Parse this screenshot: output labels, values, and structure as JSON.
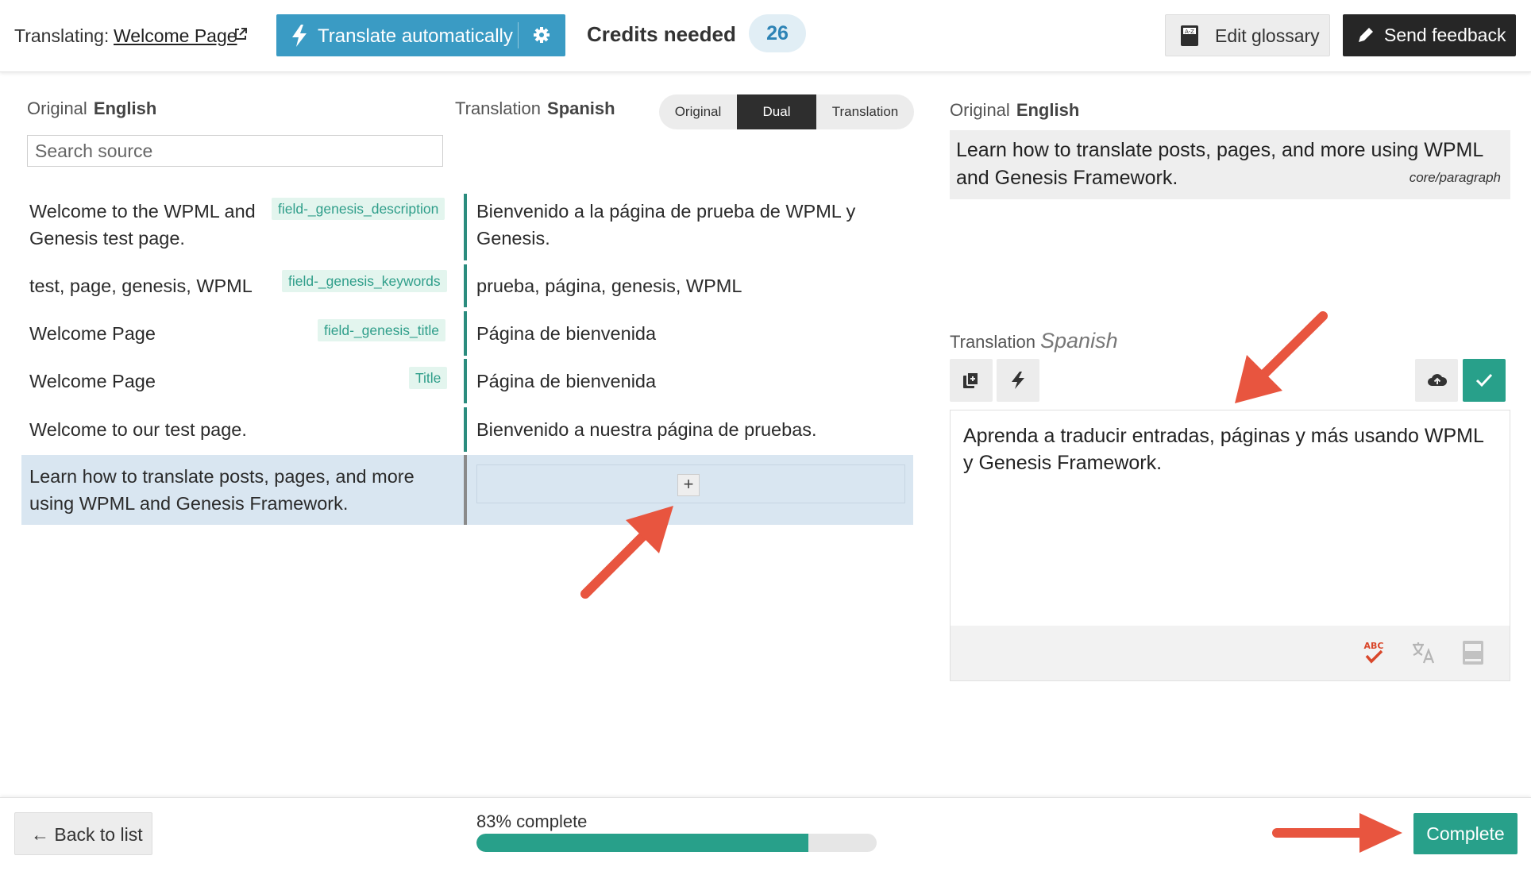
{
  "header": {
    "translating_label": "Translating:",
    "page_link": "Welcome Page",
    "translate_auto_label": "Translate automatically",
    "credits_label": "Credits needed",
    "credits_value": "26",
    "edit_glossary_label": "Edit glossary",
    "send_feedback_label": "Send feedback"
  },
  "columns": {
    "original_label": "Original",
    "original_lang": "English",
    "translation_label": "Translation",
    "translation_lang": "Spanish"
  },
  "view_toggle": {
    "options": [
      "Original",
      "Dual",
      "Translation"
    ],
    "selected": "Dual"
  },
  "search": {
    "placeholder": "Search source"
  },
  "segments": [
    {
      "source_line1": "Welcome to the WPML and",
      "source_line2": "Genesis test page.",
      "tag": "field-_genesis_description",
      "translation_line1": "Bienvenido a la página de prueba de WPML y",
      "translation_line2": "Genesis."
    },
    {
      "source": "test, page, genesis, WPML",
      "tag": "field-_genesis_keywords",
      "translation": "prueba, página, genesis, WPML"
    },
    {
      "source": "Welcome Page",
      "tag": "field-_genesis_title",
      "translation": "Página de bienvenida"
    },
    {
      "source": "Welcome Page",
      "tag": "Title",
      "translation": "Página de bienvenida"
    },
    {
      "source": "Welcome to our test page.",
      "tag": "",
      "translation": "Bienvenido a nuestra página de pruebas."
    },
    {
      "source_line1": "Learn how to translate posts, pages, and more",
      "source_line2": "using WPML and Genesis Framework.",
      "tag": "",
      "translation": "",
      "add_symbol": "+"
    }
  ],
  "right_panel": {
    "original_label": "Original",
    "original_lang": "English",
    "original_text": "Learn how to translate posts, pages, and more using WPML and Genesis Framework.",
    "block_type": "core/paragraph",
    "translation_label": "Translation",
    "translation_lang": "Spanish",
    "translation_text": "Aprenda a traducir entradas, páginas y más usando WPML y Genesis Framework.",
    "spellcheck_label": "ABC",
    "tools": [
      "copy-icon",
      "bolt-icon",
      "cloud-upload-icon",
      "check-icon"
    ],
    "footer_tools": [
      "spellcheck-icon",
      "translate-icon",
      "glossary-icon"
    ]
  },
  "footer": {
    "back_label": "← Back to list",
    "progress_label": "83% complete",
    "progress_value": 0.83,
    "complete_label": "Complete"
  },
  "colors": {
    "accent_blue": "#3a9bc4",
    "accent_green": "#28a08a",
    "arrow_red": "#e8553f"
  }
}
